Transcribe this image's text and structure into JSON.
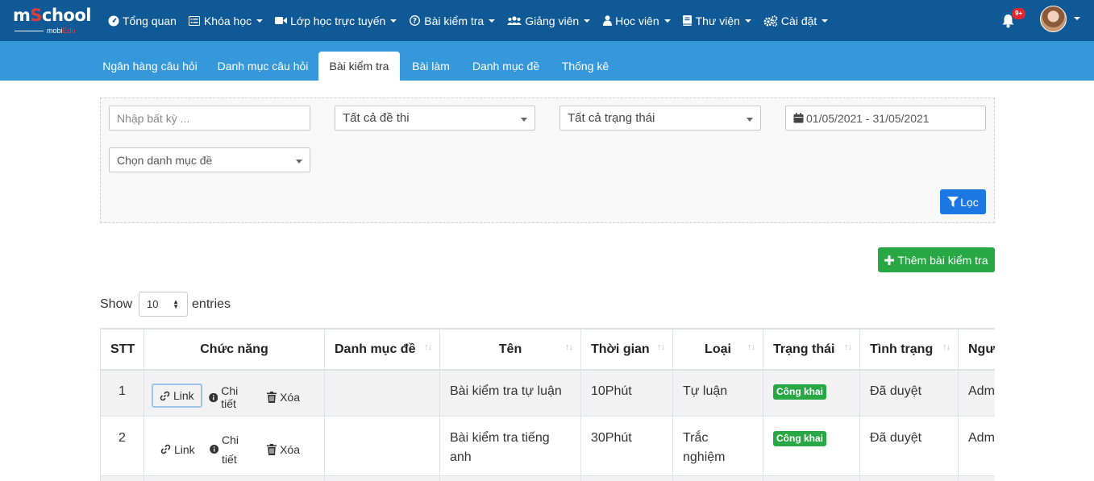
{
  "logo": {
    "brand_pre": "m",
    "brand_o": "S",
    "brand_post": "chool",
    "sub_pre": "mobi",
    "sub_post": "Edu"
  },
  "nav": [
    {
      "icon": "dashboard-icon",
      "label": "Tổng quan",
      "caret": false
    },
    {
      "icon": "list-icon",
      "label": "Khóa học",
      "caret": true
    },
    {
      "icon": "video-icon",
      "label": "Lớp học trực tuyến",
      "caret": true
    },
    {
      "icon": "question-icon",
      "label": "Bài kiểm tra",
      "caret": true
    },
    {
      "icon": "users-icon",
      "label": "Giảng viên",
      "caret": true
    },
    {
      "icon": "user-icon",
      "label": "Học viên",
      "caret": true
    },
    {
      "icon": "book-icon",
      "label": "Thư viện",
      "caret": true
    },
    {
      "icon": "cogs-icon",
      "label": "Cài đặt",
      "caret": true
    }
  ],
  "notifications": {
    "badge": "9+"
  },
  "tabs": [
    {
      "label": "Ngân hàng câu hỏi",
      "active": false
    },
    {
      "label": "Danh mục câu hỏi",
      "active": false
    },
    {
      "label": "Bài kiểm tra",
      "active": true
    },
    {
      "label": "Bài làm",
      "active": false
    },
    {
      "label": "Danh mục đề",
      "active": false
    },
    {
      "label": "Thống kê",
      "active": false
    }
  ],
  "filter": {
    "search_placeholder": "Nhập bất kỳ ...",
    "exam_select": "Tất cả đề thi",
    "status_select": "Tất cả trạng thái",
    "date_range": "01/05/2021 - 31/05/2021",
    "category_select": "Chọn danh mục đề",
    "filter_button": "Lọc"
  },
  "add_button": "Thêm bài kiểm tra",
  "entries": {
    "show": "Show",
    "value": "10",
    "suffix": "entries"
  },
  "table": {
    "headers": [
      "STT",
      "Chức năng",
      "Danh mục đề",
      "Tên",
      "Thời gian",
      "Loại",
      "Trạng thái",
      "Tình trạng",
      "Người tạo"
    ],
    "actions": {
      "link": "Link",
      "detail": "Chi tiết",
      "delete": "Xóa"
    },
    "rows": [
      {
        "stt": "1",
        "category": "",
        "name": "Bài kiểm tra tự luận",
        "time": "10Phút",
        "type": "Tự luận",
        "status": "Công khai",
        "state": "Đã duyệt",
        "creator": "Admin"
      },
      {
        "stt": "2",
        "category": "",
        "name": "Bài kiểm tra tiếng anh",
        "time": "30Phút",
        "type": "Trắc nghiệm",
        "status": "Công khai",
        "state": "Đã duyệt",
        "creator": "Admin"
      }
    ]
  },
  "colors": {
    "navbar": "#0f5a96",
    "subnav": "#3498db",
    "primary": "#1b78e2",
    "success": "#28a745",
    "badge_red": "#e3262d"
  }
}
